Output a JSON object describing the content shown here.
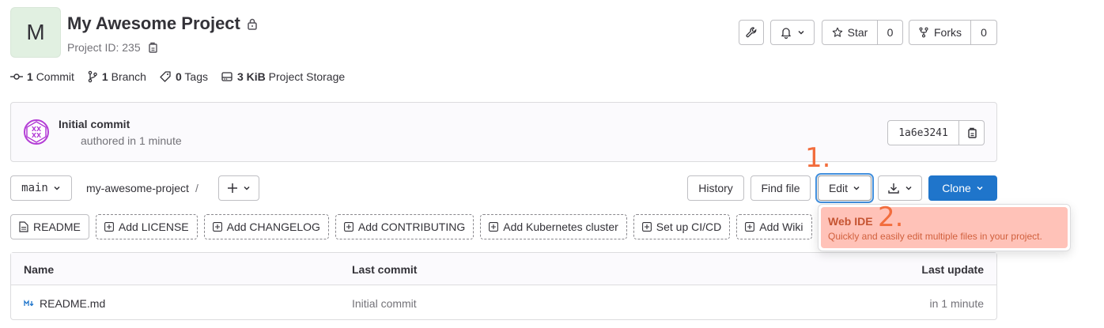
{
  "project": {
    "avatar_letter": "M",
    "title": "My Awesome Project",
    "id_label": "Project ID: 235"
  },
  "header_actions": {
    "star_label": "Star",
    "star_count": "0",
    "forks_label": "Forks",
    "forks_count": "0"
  },
  "stats": {
    "commits_count": "1",
    "commits_label": "Commit",
    "branches_count": "1",
    "branches_label": "Branch",
    "tags_count": "0",
    "tags_label": "Tags",
    "storage_count": "3 KiB",
    "storage_label": "Project Storage"
  },
  "last_commit": {
    "title": "Initial commit",
    "meta": "authored in 1 minute",
    "sha": "1a6e3241"
  },
  "repo_nav": {
    "branch": "main",
    "path": "my-awesome-project",
    "separator": "/",
    "history_label": "History",
    "find_file_label": "Find file",
    "edit_label": "Edit",
    "clone_label": "Clone"
  },
  "shortcuts": [
    {
      "label": "README",
      "style": "solid"
    },
    {
      "label": "Add LICENSE",
      "style": "dashed"
    },
    {
      "label": "Add CHANGELOG",
      "style": "dashed"
    },
    {
      "label": "Add CONTRIBUTING",
      "style": "dashed"
    },
    {
      "label": "Add Kubernetes cluster",
      "style": "dashed"
    },
    {
      "label": "Set up CI/CD",
      "style": "dashed"
    },
    {
      "label": "Add Wiki",
      "style": "dashed"
    }
  ],
  "files_table": {
    "headers": {
      "name": "Name",
      "last_commit": "Last commit",
      "last_update": "Last update"
    },
    "rows": [
      {
        "name": "README.md",
        "last_commit": "Initial commit",
        "last_update": "in 1 minute"
      }
    ]
  },
  "edit_dropdown": {
    "item_title": "Web IDE",
    "item_desc": "Quickly and easily edit multiple files in your project."
  },
  "annotations": {
    "step1": "1.",
    "step2": "2.",
    "color": "#f26d3d"
  },
  "colors": {
    "primary": "#1f75cb",
    "highlight": "#ffc2b8"
  }
}
